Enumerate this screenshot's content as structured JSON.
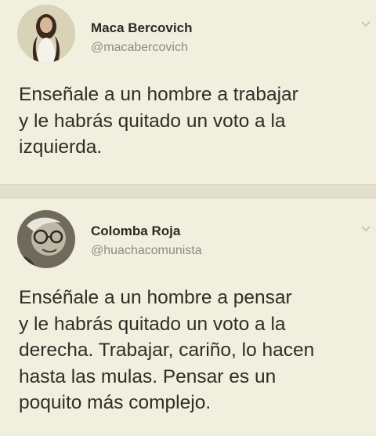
{
  "tweets": [
    {
      "author_name": "Maca Bercovich",
      "handle": "@macabercovich",
      "text": "Enseñale a un hombre a trabajar\ny le habrás quitado un voto a la\nizquierda."
    },
    {
      "author_name": "Colomba Roja",
      "handle": "@huachacomunista",
      "text": "Enséñale a un hombre a pensar\ny le habrás quitado un voto a la\nderecha. Trabajar, cariño, lo hacen\nhasta las mulas. Pensar es un\npoquito más complejo."
    }
  ],
  "icons": {
    "menu": "chevron-down-icon"
  },
  "colors": {
    "background": "#f1efdd",
    "text": "#2f2e28",
    "handle": "#8e8c7d",
    "separator": "#e2dfcb"
  }
}
